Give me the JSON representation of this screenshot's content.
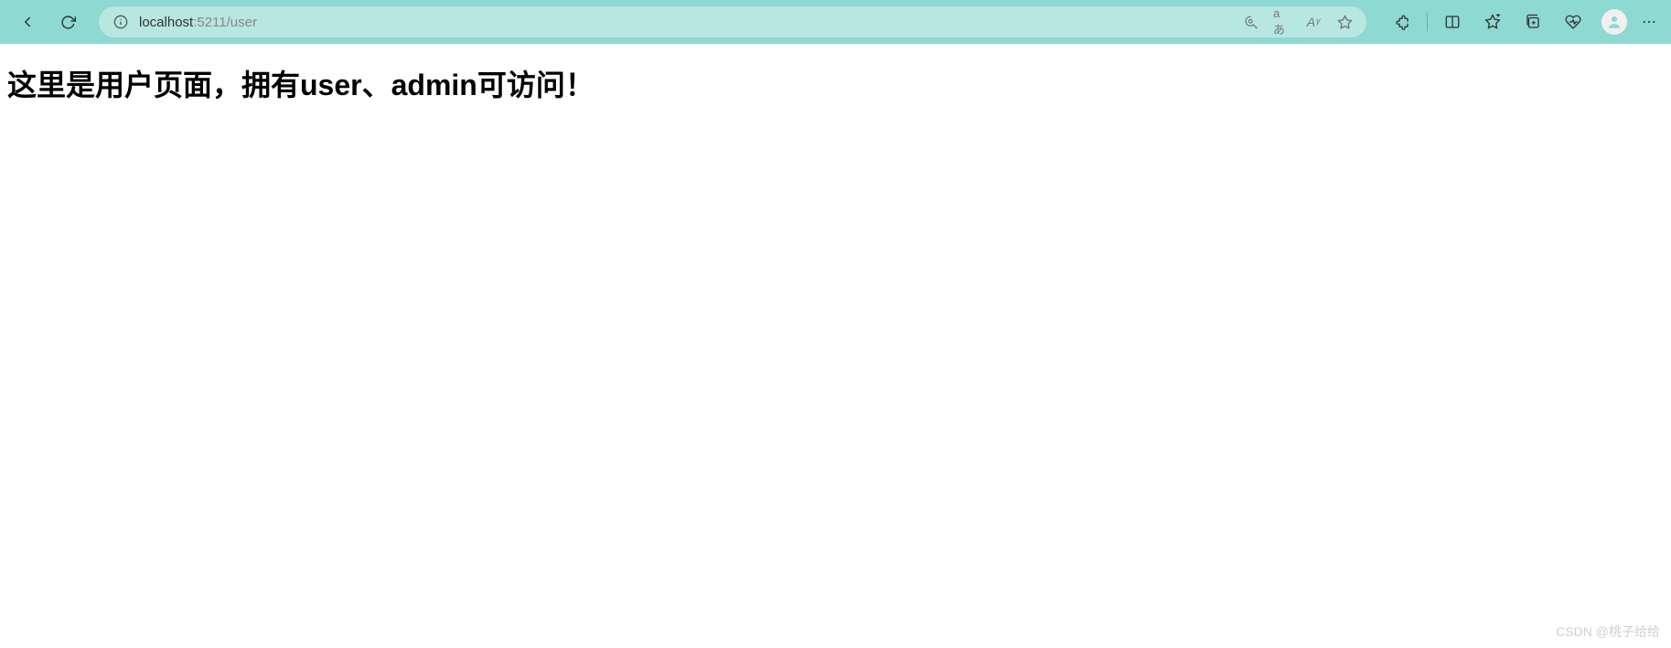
{
  "browser": {
    "url": {
      "host": "localhost",
      "port": ":5211",
      "path": "/user"
    },
    "addr_actions": {
      "search": "search-icon",
      "translate": "aあ",
      "read_aloud": "Aᵞ",
      "favorite": "favorite-star-icon"
    },
    "toolbar": {
      "extensions": "puzzle-icon",
      "split": "split-screen-icon",
      "favorites": "favorites-star-plus-icon",
      "collections": "collections-icon",
      "performance": "heartbeat-icon",
      "profile": "profile-avatar-icon",
      "more": "⋯"
    }
  },
  "page": {
    "heading": "这里是用户页面，拥有user、admin可访问！"
  },
  "watermark": "CSDN @桃子给给"
}
